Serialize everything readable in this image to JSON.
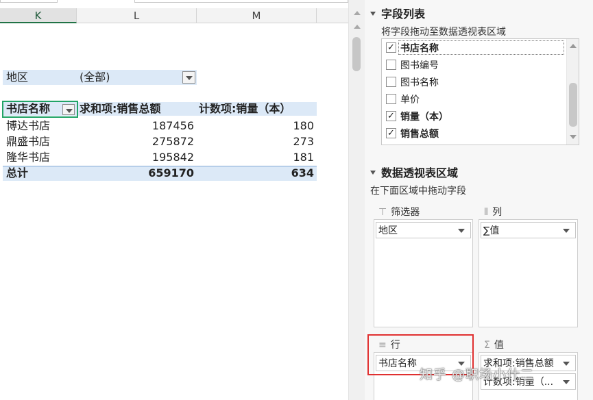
{
  "sheet": {
    "columns": [
      "K",
      "L",
      "M"
    ],
    "filter": {
      "label": "地区",
      "value": "(全部)"
    },
    "headers": [
      "书店名称",
      "求和项:销售总额",
      "计数项:销量（本）"
    ],
    "rows": [
      {
        "name": "博达书店",
        "sales": "187456",
        "count": "180"
      },
      {
        "name": "鼎盛书店",
        "sales": "275872",
        "count": "273"
      },
      {
        "name": "隆华书店",
        "sales": "195842",
        "count": "181"
      }
    ],
    "total": {
      "label": "总计",
      "sales": "659170",
      "count": "634"
    }
  },
  "pane": {
    "field_list_title": "字段列表",
    "field_list_hint": "将字段拖动至数据透视表区域",
    "fields": [
      {
        "label": "书店名称",
        "checked": true
      },
      {
        "label": "图书编号",
        "checked": false
      },
      {
        "label": "图书名称",
        "checked": false
      },
      {
        "label": "单价",
        "checked": false
      },
      {
        "label": "销量（本）",
        "checked": true
      },
      {
        "label": "销售总额",
        "checked": true
      }
    ],
    "areas_title": "数据透视表区域",
    "areas_hint": "在下面区域中拖动字段",
    "filters_area": {
      "label": "筛选器",
      "items": [
        "地区"
      ]
    },
    "columns_area": {
      "label": "列",
      "items": [
        "∑值"
      ]
    },
    "rows_area": {
      "label": "行",
      "items": [
        "书店名称"
      ]
    },
    "values_area": {
      "label": "值",
      "items": [
        "求和项:销售总额",
        "计数项:销量（..."
      ]
    }
  },
  "watermark": "知乎 @职场小什二",
  "colors": {
    "accent_green": "#217346",
    "selection_green": "#21a366",
    "header_blue": "#dce9f7",
    "highlight_red": "#e03030"
  }
}
